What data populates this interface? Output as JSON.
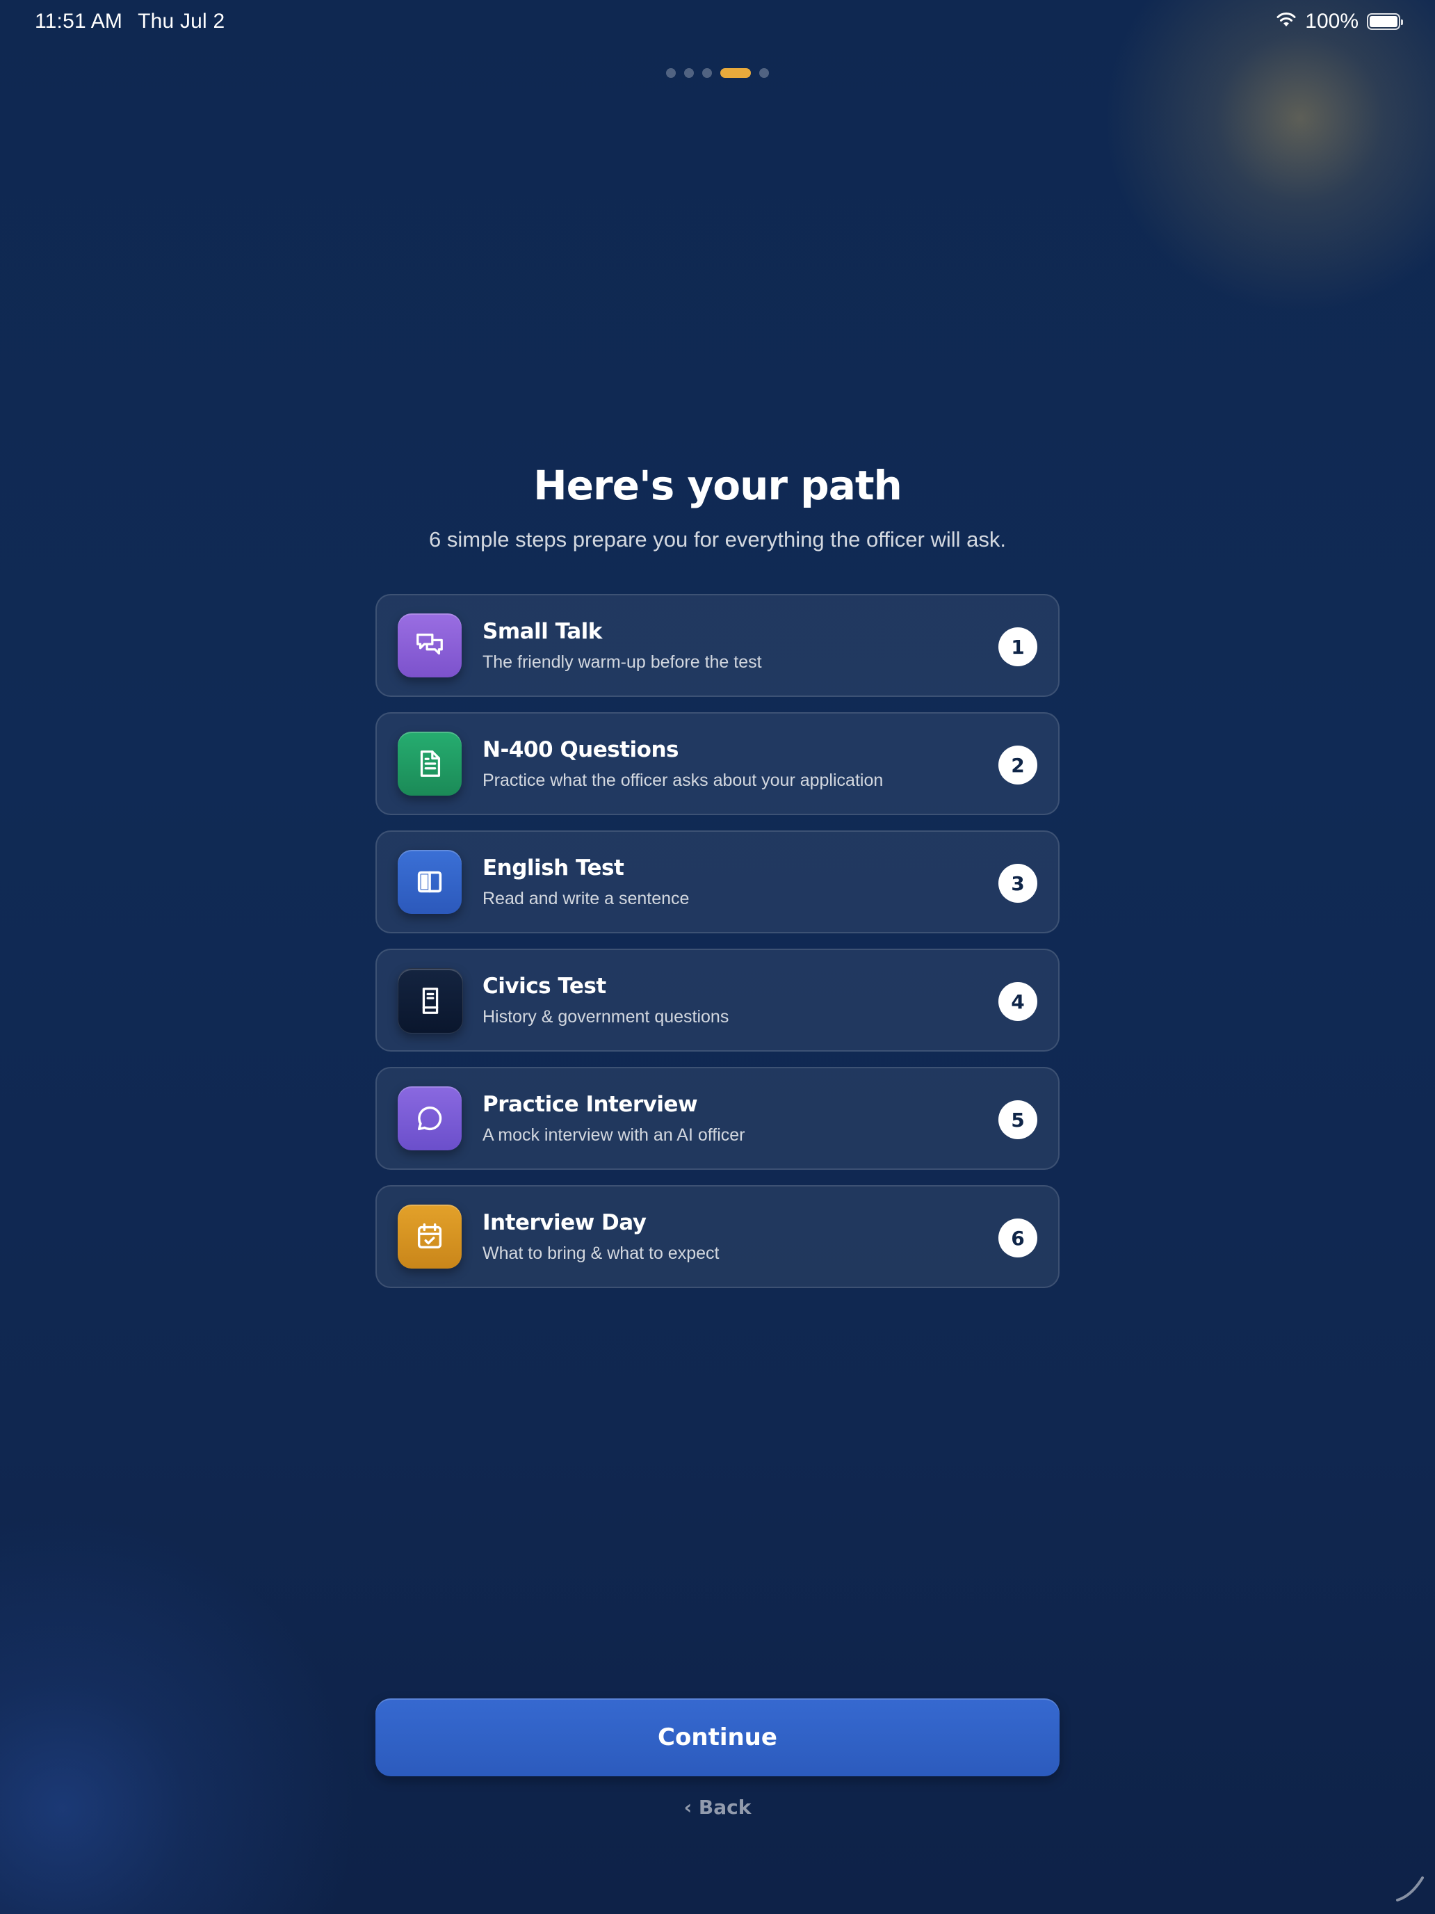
{
  "status_bar": {
    "time": "11:51 AM",
    "date": "Thu Jul 2",
    "battery": "100%"
  },
  "pager": {
    "total": 5,
    "active_index": 3,
    "active_color": "#e8aa3c"
  },
  "header": {
    "title": "Here's your path",
    "subtitle": "6 simple steps prepare you for everything the officer will ask."
  },
  "steps": [
    {
      "number": "1",
      "title": "Small Talk",
      "description": "The friendly warm-up before the test",
      "icon": "chat-bubbles-icon",
      "color": "#8a5fd6"
    },
    {
      "number": "2",
      "title": "N-400 Questions",
      "description": "Practice what the officer asks about your application",
      "icon": "document-icon",
      "color": "#1f9a63"
    },
    {
      "number": "3",
      "title": "English Test",
      "description": "Read and write a sentence",
      "icon": "open-book-icon",
      "color": "#3566c9"
    },
    {
      "number": "4",
      "title": "Civics Test",
      "description": "History & government questions",
      "icon": "book-icon",
      "color": "#0c1a33"
    },
    {
      "number": "5",
      "title": "Practice Interview",
      "description": "A mock interview with an AI officer",
      "icon": "speech-bubble-icon",
      "color": "#7b5cd6"
    },
    {
      "number": "6",
      "title": "Interview Day",
      "description": "What to bring & what to expect",
      "icon": "calendar-check-icon",
      "color": "#d99621"
    }
  ],
  "actions": {
    "continue_label": "Continue",
    "back_label": "‹ Back"
  }
}
